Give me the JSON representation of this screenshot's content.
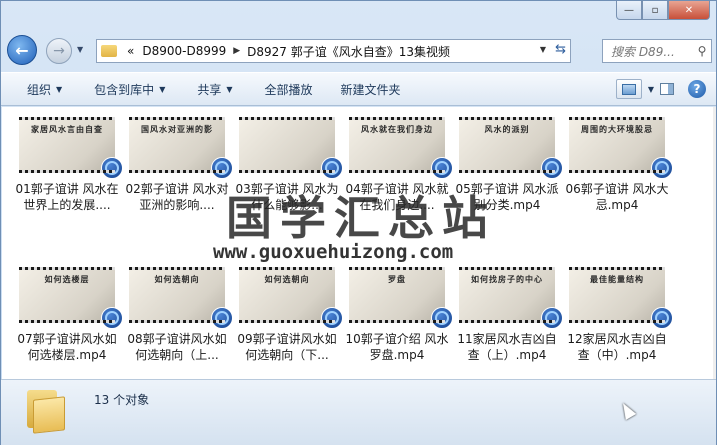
{
  "window": {
    "controls": {
      "minimize": "—",
      "maximize": "▫",
      "close": "✕"
    }
  },
  "navigation": {
    "back_glyph": "←",
    "forward_glyph": "→",
    "breadcrumbs": [
      {
        "label": "«"
      },
      {
        "label": "D8900-D8999"
      },
      {
        "label": "D8927 郭子谊《风水自查》13集视频"
      }
    ],
    "search_placeholder": "搜索 D89..."
  },
  "toolbar": {
    "items": [
      {
        "label": "组织",
        "has_dropdown": true
      },
      {
        "label": "包含到库中",
        "has_dropdown": true
      },
      {
        "label": "共享",
        "has_dropdown": true
      },
      {
        "label": "全部播放",
        "has_dropdown": false
      },
      {
        "label": "新建文件夹",
        "has_dropdown": false
      }
    ],
    "help_label": "?"
  },
  "files": [
    {
      "thumb_text": "家居风水言由自查",
      "name": "01郭子谊讲 风水在世界上的发展...."
    },
    {
      "thumb_text": "国风水对亚洲的影",
      "name": "02郭子谊讲 风水对亚洲的影响...."
    },
    {
      "thumb_text": "",
      "name": "03郭子谊讲 风水为什么能够影..."
    },
    {
      "thumb_text": "风水就在我们身边",
      "name": "04郭子谊讲 风水就在我们身边...."
    },
    {
      "thumb_text": "风水的派别",
      "name": "05郭子谊讲 风水派别分类.mp4"
    },
    {
      "thumb_text": "周围的大环境股忌",
      "name": "06郭子谊讲 风水大忌.mp4"
    },
    {
      "thumb_text": "如何选楼层",
      "name": "07郭子谊讲风水如何选楼层.mp4"
    },
    {
      "thumb_text": "如何选朝向",
      "name": "08郭子谊讲风水如何选朝向（上..."
    },
    {
      "thumb_text": "如何选朝向",
      "name": "09郭子谊讲风水如何选朝向（下..."
    },
    {
      "thumb_text": "罗盘",
      "name": "10郭子谊介绍 风水罗盘.mp4"
    },
    {
      "thumb_text": "如何找房子的中心",
      "name": "11家居风水吉凶自查（上）.mp4"
    },
    {
      "thumb_text": "最佳能量结构",
      "name": "12家居风水吉凶自查（中）.mp4"
    }
  ],
  "watermark": {
    "text": "国学汇总站",
    "url": "www.guoxuehuizong.com"
  },
  "status": {
    "count_text": "13 个对象"
  },
  "colors": {
    "accent": "#1f5fb8",
    "toolbar_text": "#1e395b",
    "window_chrome": "#c3d8ef"
  }
}
